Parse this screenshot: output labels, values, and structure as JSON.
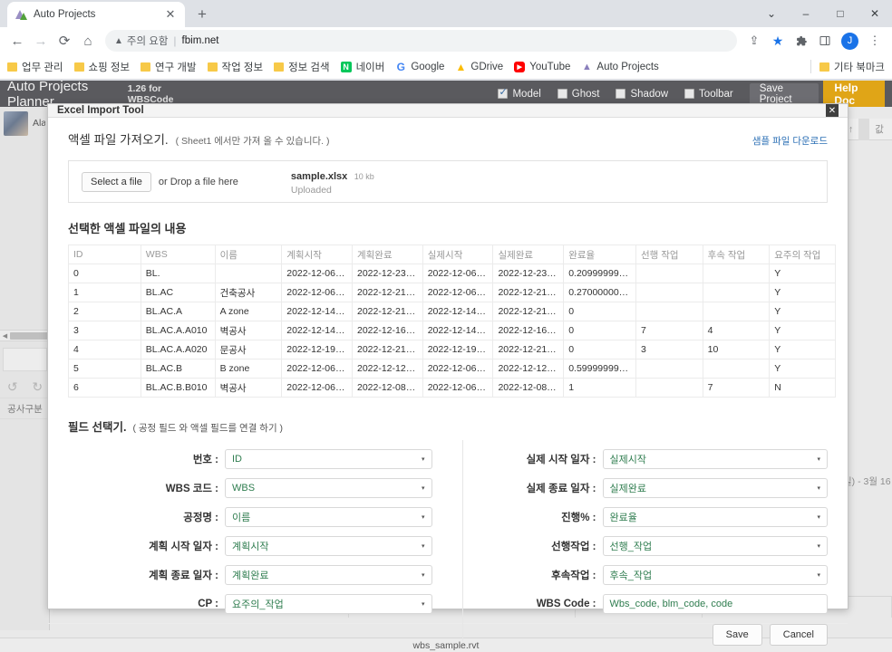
{
  "browser": {
    "tab": {
      "title": "Auto Projects",
      "favicon": "auto-projects-favicon",
      "close": "✕"
    },
    "newtab": "+",
    "window_controls": {
      "minimize_group": "⌄",
      "minimize": "–",
      "maximize": "□",
      "close": "✕"
    },
    "nav": {
      "back": "←",
      "forward": "→",
      "reload": "⟳",
      "home": "⌂"
    },
    "omnibox": {
      "warning_icon": "▲",
      "warning_text": "주의 요함",
      "separator": "|",
      "url": "fbim.net"
    },
    "toolbar_icons": {
      "share": "⇪",
      "bookmark_star": "★",
      "extensions": "🧩",
      "side_panel": "▯",
      "profile_initial": "J",
      "menu": "⋮"
    },
    "bookmarks": [
      {
        "label": "업무 관리",
        "icon": "folder-icon"
      },
      {
        "label": "쇼핑 정보",
        "icon": "folder-icon"
      },
      {
        "label": "연구 개발",
        "icon": "folder-icon"
      },
      {
        "label": "작업 정보",
        "icon": "folder-icon"
      },
      {
        "label": "정보 검색",
        "icon": "folder-icon"
      },
      {
        "label": "네이버",
        "icon": "naver-icon",
        "glyph": "N"
      },
      {
        "label": "Google",
        "icon": "google-icon",
        "glyph": "G"
      },
      {
        "label": "GDrive",
        "icon": "gdrive-icon",
        "glyph": "▲"
      },
      {
        "label": "YouTube",
        "icon": "youtube-icon",
        "glyph": "▶"
      },
      {
        "label": "Auto Projects",
        "icon": "auto-projects-icon",
        "glyph": "▲"
      }
    ],
    "other_bookmarks": {
      "label": "기타 북마크",
      "icon": "folder-icon"
    }
  },
  "app_header": {
    "title": "Auto Projects Planner",
    "version": "1.26 for WBSCode",
    "checkboxes": [
      {
        "label": "Model",
        "checked": true
      },
      {
        "label": "Ghost",
        "checked": false
      },
      {
        "label": "Shadow",
        "checked": false
      },
      {
        "label": "Toolbar",
        "checked": false
      }
    ],
    "save_project": "Save Project",
    "help_doc": "Help Doc"
  },
  "background": {
    "sidebar_user": "Ala",
    "scroll_arrow": "◀",
    "undo": "↺",
    "redo": "↻",
    "construction_label": "공사구분",
    "right_header_sort": "↑",
    "right_header_value": "값",
    "right_date_fragment": "일) - 3월 16",
    "statusbar_file": "wbs_sample.rvt"
  },
  "dialog": {
    "title": "Excel Import Tool",
    "close": "✕",
    "import_section": {
      "title": "액셀 파일 가져오기.",
      "note": "( Sheet1 에서만 가져 올 수 있습니다. )",
      "sample_link": "샘플 파일 다운로드",
      "select_file_button": "Select a file",
      "drop_hint": "or Drop a file here",
      "file_name": "sample.xlsx",
      "file_size": "10 kb",
      "file_status": "Uploaded"
    },
    "preview_section": {
      "title": "선택한 액셀 파일의 내용",
      "columns": [
        "ID",
        "WBS",
        "이름",
        "계획시작",
        "계획완료",
        "실제시작",
        "실제완료",
        "완료율",
        "선행 작업",
        "후속 작업",
        "요주의 작업"
      ],
      "rows": [
        [
          "0",
          "BL.",
          "",
          "2022-12-06T0...",
          "2022-12-23T0...",
          "2022-12-06T0...",
          "2022-12-23T0...",
          "0.2099999999...",
          "",
          "",
          "Y"
        ],
        [
          "1",
          "BL.AC",
          "건축공사",
          "2022-12-06T0...",
          "2022-12-21T0...",
          "2022-12-06T0...",
          "2022-12-21T0...",
          "0.2700000000...",
          "",
          "",
          "Y"
        ],
        [
          "2",
          "BL.AC.A",
          "A zone",
          "2022-12-14T0...",
          "2022-12-21T0...",
          "2022-12-14T0...",
          "2022-12-21T0...",
          "0",
          "",
          "",
          "Y"
        ],
        [
          "3",
          "BL.AC.A.A010",
          "벽공사",
          "2022-12-14T0...",
          "2022-12-16T0...",
          "2022-12-14T0...",
          "2022-12-16T0...",
          "0",
          "7",
          "4",
          "Y"
        ],
        [
          "4",
          "BL.AC.A.A020",
          "문공사",
          "2022-12-19T0...",
          "2022-12-21T0...",
          "2022-12-19T0...",
          "2022-12-21T0...",
          "0",
          "3",
          "10",
          "Y"
        ],
        [
          "5",
          "BL.AC.B",
          "B zone",
          "2022-12-06T0...",
          "2022-12-12T0...",
          "2022-12-06T0...",
          "2022-12-12T0...",
          "0.5999999999...",
          "",
          "",
          "Y"
        ],
        [
          "6",
          "BL.AC.B.B010",
          "벽공사",
          "2022-12-06T0...",
          "2022-12-08T0...",
          "2022-12-06T0...",
          "2022-12-08T0...",
          "1",
          "",
          "7",
          "N"
        ]
      ]
    },
    "mapping_section": {
      "title": "필드 선택기.",
      "note": "( 공정 필드 와 액셀 필드를 연결 하기 )",
      "caret": "▾",
      "left_fields": [
        {
          "label": "번호 :",
          "value": "ID"
        },
        {
          "label": "WBS 코드 :",
          "value": "WBS"
        },
        {
          "label": "공정명 :",
          "value": "이름"
        },
        {
          "label": "계획 시작 일자 :",
          "value": "계획시작"
        },
        {
          "label": "계획 종료 일자 :",
          "value": "계획완료"
        },
        {
          "label": "CP :",
          "value": "요주의_작업"
        }
      ],
      "right_fields": [
        {
          "label": "실제 시작 일자 :",
          "value": "실제시작",
          "type": "select"
        },
        {
          "label": "실제 종료 일자 :",
          "value": "실제완료",
          "type": "select"
        },
        {
          "label": "진행% :",
          "value": "완료율",
          "type": "select"
        },
        {
          "label": "선행작업 :",
          "value": "선행_작업",
          "type": "select"
        },
        {
          "label": "후속작업 :",
          "value": "후속_작업",
          "type": "select"
        },
        {
          "label": "WBS Code :",
          "value": "Wbs_code, blm_code, code",
          "type": "input"
        }
      ]
    },
    "footer": {
      "save": "Save",
      "cancel": "Cancel"
    }
  },
  "colors": {
    "app_header_bg": "#5a5a5e",
    "help_doc_bg": "#e0a517",
    "accent_link": "#2b6fb5",
    "field_value_green": "#2f7d4f",
    "browser_accent": "#1a73e8"
  }
}
